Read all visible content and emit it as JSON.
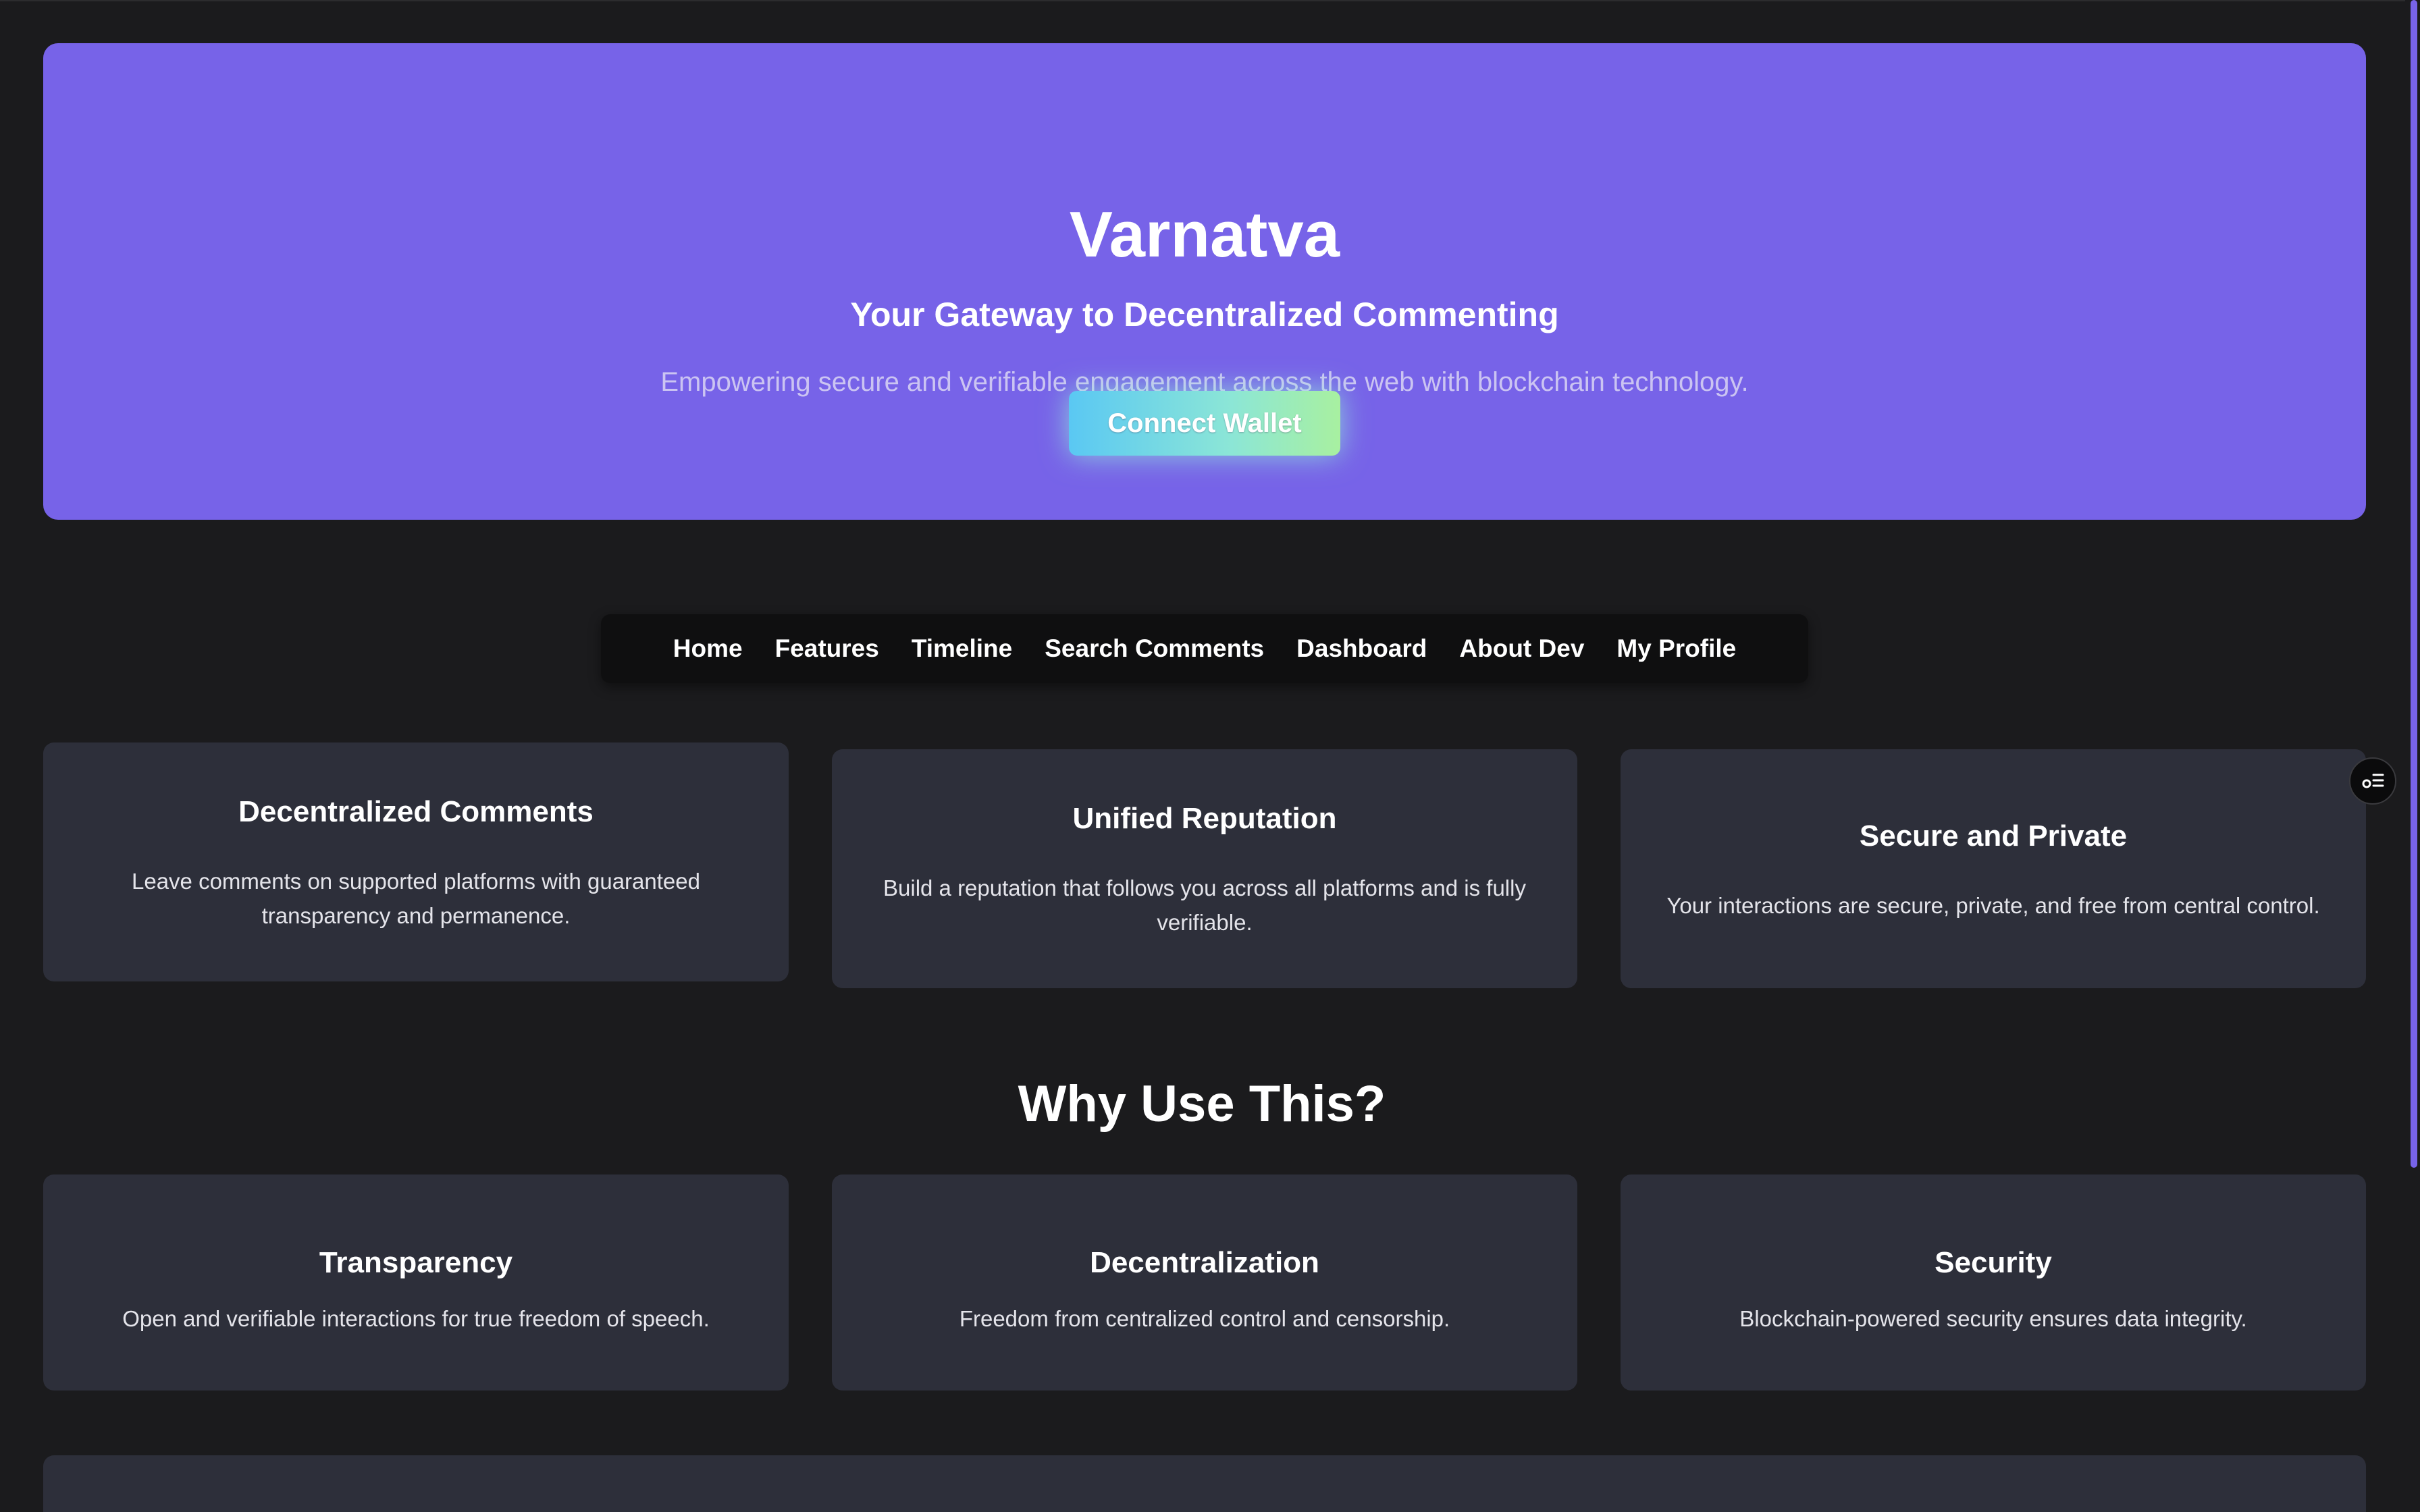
{
  "hero": {
    "title": "Varnatva",
    "subtitle": "Your Gateway to Decentralized Commenting",
    "description": "Empowering secure and verifiable engagement across the web with blockchain technology.",
    "connect_button": "Connect Wallet"
  },
  "nav": {
    "items": [
      "Home",
      "Features",
      "Timeline",
      "Search Comments",
      "Dashboard",
      "About Dev",
      "My Profile"
    ]
  },
  "features": [
    {
      "title": "Decentralized Comments",
      "text": "Leave comments on supported platforms with guaranteed transparency and permanence."
    },
    {
      "title": "Unified Reputation",
      "text": "Build a reputation that follows you across all platforms and is fully verifiable."
    },
    {
      "title": "Secure and Private",
      "text": "Your interactions are secure, private, and free from central control."
    }
  ],
  "why": {
    "title": "Why Use This?",
    "items": [
      {
        "title": "Transparency",
        "text": "Open and verifiable interactions for true freedom of speech."
      },
      {
        "title": "Decentralization",
        "text": "Freedom from centralized control and censorship."
      },
      {
        "title": "Security",
        "text": "Blockchain-powered security ensures data integrity."
      }
    ]
  },
  "floating_button_icon": "settings-list-icon",
  "colors": {
    "background": "#1b1b1d",
    "hero": "#7763e8",
    "card": "#2d2f3a",
    "nav": "#0f0f10",
    "button_gradient_start": "#5ac8f3",
    "button_gradient_end": "#a8f0a0"
  }
}
